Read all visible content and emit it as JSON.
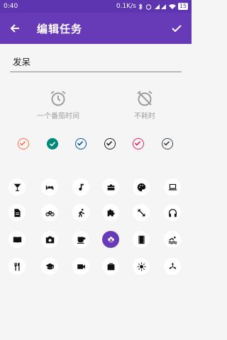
{
  "status": {
    "time": "0:40",
    "net_speed": "0.1K/s",
    "battery": "15"
  },
  "appbar": {
    "title": "编辑任务",
    "back_icon": "arrow-back-icon",
    "confirm_icon": "check-icon"
  },
  "task": {
    "name_value": "发呆"
  },
  "modes": [
    {
      "label": "一个番茄时间",
      "icon": "alarm-icon"
    },
    {
      "label": "不耗时",
      "icon": "alarm-off-icon"
    }
  ],
  "colors": [
    "#ff7043",
    "#00897b",
    "#01579b",
    "#212121",
    "#e91e63",
    "#37474f"
  ],
  "selected_color_index": 1,
  "icons": [
    "cocktail-icon",
    "bed-icon",
    "music-note-icon",
    "briefcase-tools-icon",
    "palette-icon",
    "laptop-icon",
    "document-icon",
    "bicycle-icon",
    "running-icon",
    "puzzle-icon",
    "expand-arrows-icon",
    "headphones-icon",
    "book-open-icon",
    "camera-icon",
    "coffee-cup-icon",
    "flower-icon",
    "film-icon",
    "swimming-icon",
    "restaurant-icon",
    "graduation-cap-icon",
    "video-camera-icon",
    "bag-icon",
    "sun-icon",
    "fan-icon"
  ],
  "selected_icon_index": 15
}
